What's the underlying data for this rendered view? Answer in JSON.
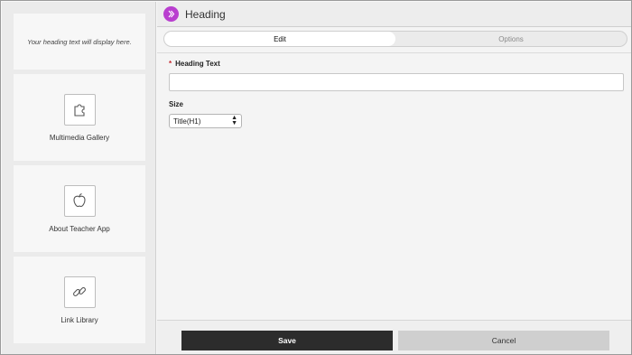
{
  "left_panel": {
    "heading_placeholder": "Your heading text will display here.",
    "tiles": [
      {
        "label": "Multimedia Gallery",
        "icon": "puzzle-icon"
      },
      {
        "label": "About Teacher App",
        "icon": "apple-icon"
      },
      {
        "label": "Link Library",
        "icon": "link-icon"
      }
    ]
  },
  "header": {
    "title": "Heading",
    "icon": "double-chevron-right-icon",
    "icon_color": "#b93fcf"
  },
  "tabs": [
    {
      "label": "Edit",
      "active": true
    },
    {
      "label": "Options",
      "active": false
    }
  ],
  "form": {
    "heading_text_label": "Heading Text",
    "required_marker": "*",
    "heading_text_value": "",
    "size_label": "Size",
    "size_selected": "Title(H1)"
  },
  "footer": {
    "save_label": "Save",
    "cancel_label": "Cancel"
  },
  "colors": {
    "save_button": "#2c2c2c",
    "cancel_button": "#cfcfcf",
    "required": "#c4282e"
  }
}
